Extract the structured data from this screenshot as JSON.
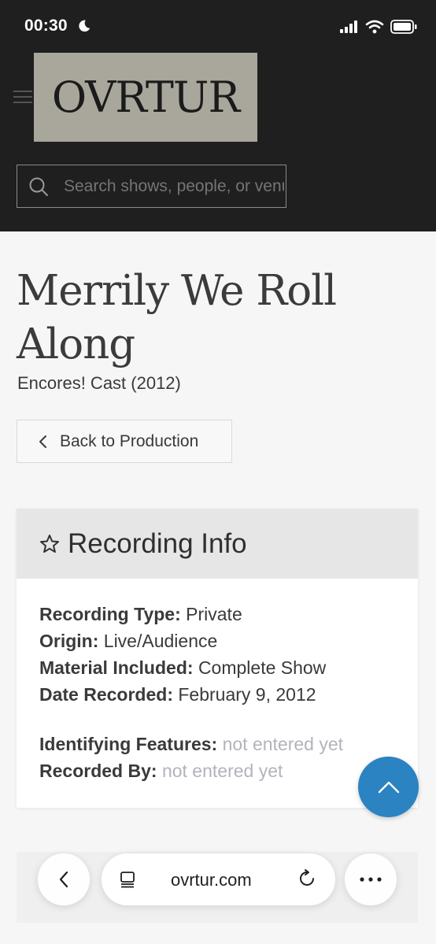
{
  "status_bar": {
    "time": "00:30"
  },
  "header": {
    "logo_text": "OVRTUR",
    "search": {
      "placeholder": "Search shows, people, or venues"
    }
  },
  "production": {
    "title": "Merrily We Roll Along",
    "subtitle": "Encores! Cast (2012)",
    "back_label": "Back to Production"
  },
  "recording_info": {
    "title": "Recording Info",
    "fields": [
      {
        "label": "Recording Type:",
        "value": "Private"
      },
      {
        "label": "Origin:",
        "value": "Live/Audience"
      },
      {
        "label": "Material Included:",
        "value": "Complete Show"
      },
      {
        "label": "Date Recorded:",
        "value": "February 9, 2012"
      }
    ],
    "extra_fields": [
      {
        "label": "Identifying Features:",
        "value": "not entered yet"
      },
      {
        "label": "Recorded By:",
        "value": "not entered yet"
      }
    ]
  },
  "browser": {
    "url": "ovrtur.com"
  },
  "colors": {
    "header_bg": "#1f1f1f",
    "logo_bg": "#a9a79b",
    "accent": "#2b83c2",
    "muted_text": "#b3b3bd"
  },
  "icons": [
    "moon-icon",
    "signal-icon",
    "wifi-icon",
    "battery-icon",
    "menu-icon",
    "search-icon",
    "chevron-left-icon",
    "star-icon",
    "chevron-up-icon",
    "tabs-icon",
    "reload-icon",
    "more-icon"
  ]
}
